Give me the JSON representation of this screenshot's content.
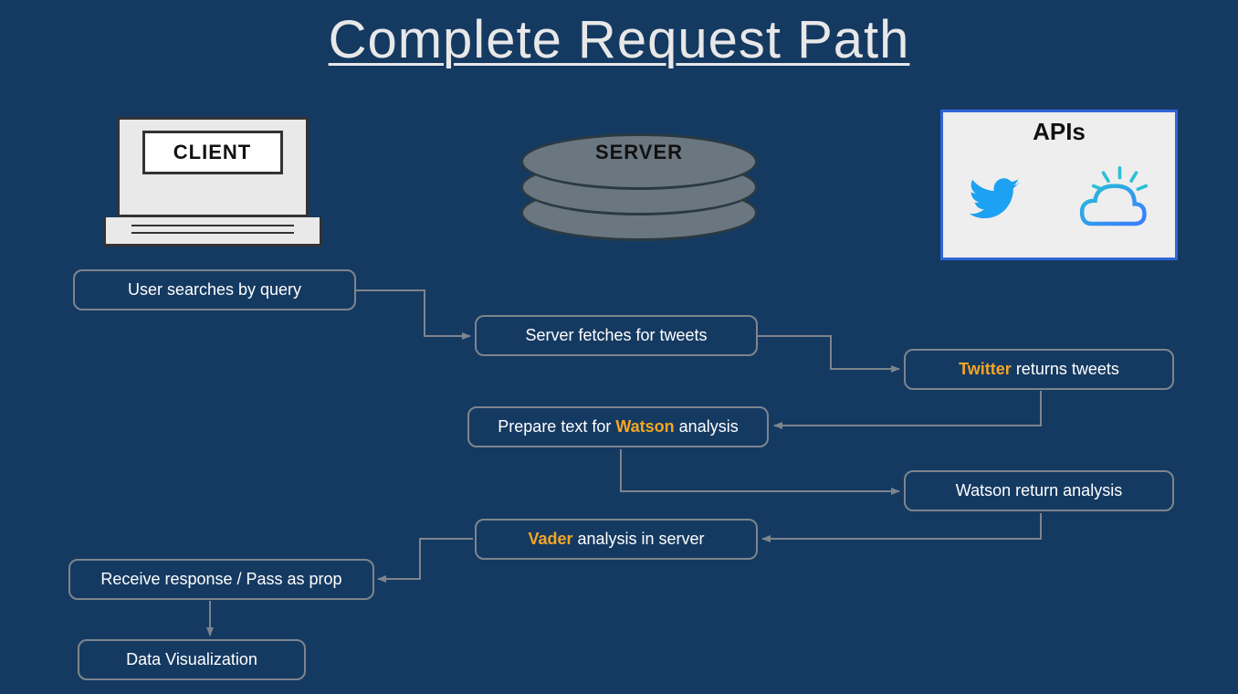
{
  "title": "Complete Request Path",
  "columns": {
    "client_label": "CLIENT",
    "server_label": "SERVER",
    "apis_label": "APIs",
    "api_icons": [
      "twitter-icon",
      "ibm-watson-icon"
    ]
  },
  "steps": {
    "user_search": "User searches by query",
    "server_fetch": "Server fetches for tweets",
    "twitter_returns_prefix": "Twitter",
    "twitter_returns_suffix": " returns tweets",
    "prepare_prefix": "Prepare text for ",
    "prepare_accent": "Watson",
    "prepare_suffix": " analysis",
    "watson_return": "Watson return analysis",
    "vader_accent": "Vader",
    "vader_suffix": " analysis in server",
    "receive": "Receive response / Pass as prop",
    "dataviz": "Data Visualization"
  },
  "colors": {
    "background": "#153a62",
    "box_border": "#7d858d",
    "accent": "#f5a623",
    "arrow": "#7d858d",
    "twitter": "#1da1f2",
    "watson_gradient_a": "#29c0d6",
    "watson_gradient_b": "#3a7bff"
  }
}
